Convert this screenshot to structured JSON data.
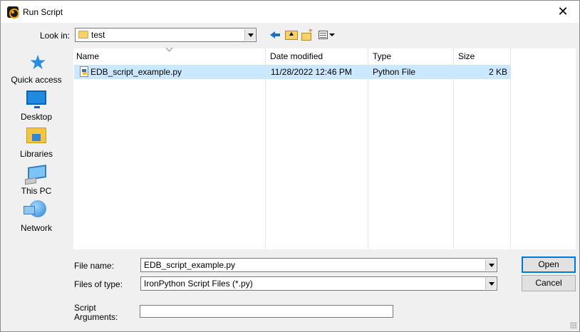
{
  "window": {
    "title": "Run Script",
    "close_glyph": "✕"
  },
  "toolbar": {
    "look_in_label": "Look in:",
    "look_in_value": "test"
  },
  "places": [
    {
      "label": "Quick access",
      "icon": "star-icon"
    },
    {
      "label": "Desktop",
      "icon": "desktop-icon"
    },
    {
      "label": "Libraries",
      "icon": "libraries-icon"
    },
    {
      "label": "This PC",
      "icon": "computer-icon"
    },
    {
      "label": "Network",
      "icon": "network-icon"
    }
  ],
  "list": {
    "columns": [
      "Name",
      "Date modified",
      "Type",
      "Size"
    ],
    "rows": [
      {
        "name": "EDB_script_example.py",
        "date": "11/28/2022 12:46 PM",
        "type": "Python File",
        "size": "2 KB"
      }
    ]
  },
  "form": {
    "file_name_label": "File name:",
    "file_name_value": "EDB_script_example.py",
    "file_type_label": "Files of type:",
    "file_type_value": "IronPython Script Files (*.py)",
    "script_args_label_1": "Script",
    "script_args_label_2": "Arguments:",
    "script_args_value": ""
  },
  "buttons": {
    "open": "Open",
    "cancel": "Cancel"
  },
  "colors": {
    "selection": "#cce8ff",
    "accent": "#0078d7"
  }
}
